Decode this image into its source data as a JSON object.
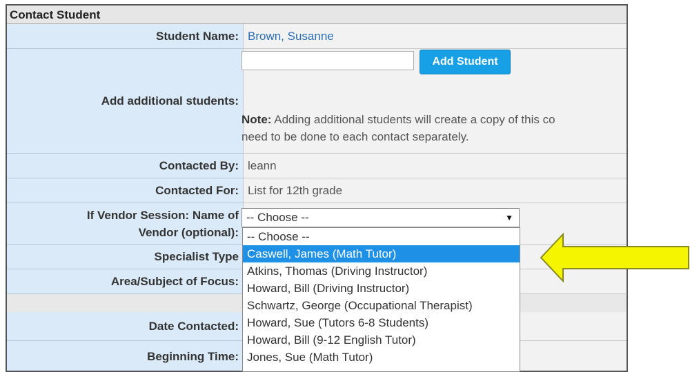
{
  "form": {
    "header": "Contact Student",
    "rows": {
      "student_name": {
        "label": "Student Name:",
        "value": "Brown, Susanne"
      },
      "add_students": {
        "label": "Add additional students:",
        "button_label": "Add Student",
        "input_value": "",
        "note_prefix": "Note:",
        "note_line1": " Adding additional students will create a copy of this co",
        "note_line2": "need to be done to each contact separately."
      },
      "contacted_by": {
        "label": "Contacted By:",
        "value": "leann"
      },
      "contacted_for": {
        "label": "Contacted For:",
        "value": "List for 12th grade"
      },
      "vendor": {
        "label_line1": "If Vendor Session: Name of",
        "label_line2": "Vendor (optional):",
        "selected": "-- Choose --"
      },
      "specialist_type": {
        "label": "Specialist Type"
      },
      "area_focus": {
        "label": "Area/Subject of Focus:"
      },
      "date_contacted": {
        "label": "Date Contacted:"
      },
      "beginning_time": {
        "label": "Beginning Time:"
      }
    }
  },
  "dropdown": {
    "options": [
      "-- Choose --",
      "Caswell, James (Math Tutor)",
      "Atkins, Thomas (Driving Instructor)",
      "Howard, Bill (Driving Instructor)",
      "Schwartz, George (Occupational Therapist)",
      "Howard, Sue (Tutors 6-8 Students)",
      "Howard, Bill (9-12 English Tutor)",
      "Jones, Sue (Math Tutor)"
    ],
    "highlighted_index": 1
  },
  "colors": {
    "label_bg": "#daeaf8",
    "link": "#2a6fb6",
    "button": "#17a0e6",
    "highlight": "#1e90e6",
    "arrow": "#f5f500"
  },
  "icons": {
    "select_caret": "caret-down-icon",
    "pointer": "yellow-arrow-icon"
  }
}
